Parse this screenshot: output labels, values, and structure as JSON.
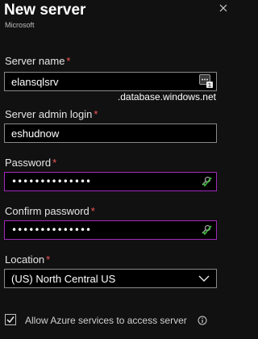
{
  "header": {
    "title": "New server",
    "subtitle": "Microsoft"
  },
  "fields": {
    "server_name": {
      "label": "Server name",
      "required_mark": "*",
      "value": "elansqlsrv",
      "suffix": ".database.windows.net",
      "icon": "password-manager-icon"
    },
    "admin_login": {
      "label": "Server admin login",
      "required_mark": "*",
      "value": "eshudnow"
    },
    "password": {
      "label": "Password",
      "required_mark": "*",
      "masked_value": "••••••••••••••",
      "icon": "key-check-icon"
    },
    "confirm_password": {
      "label": "Confirm password",
      "required_mark": "*",
      "masked_value": "••••••••••••••",
      "icon": "key-check-icon"
    },
    "location": {
      "label": "Location",
      "required_mark": "*",
      "selected": "(US) North Central US"
    }
  },
  "allow_azure": {
    "label": "Allow Azure services to access server",
    "checked": true
  },
  "colors": {
    "background": "#111111",
    "required": "#f4575a",
    "focus_border": "#a02ab8",
    "valid_check": "#3fbf3f"
  }
}
